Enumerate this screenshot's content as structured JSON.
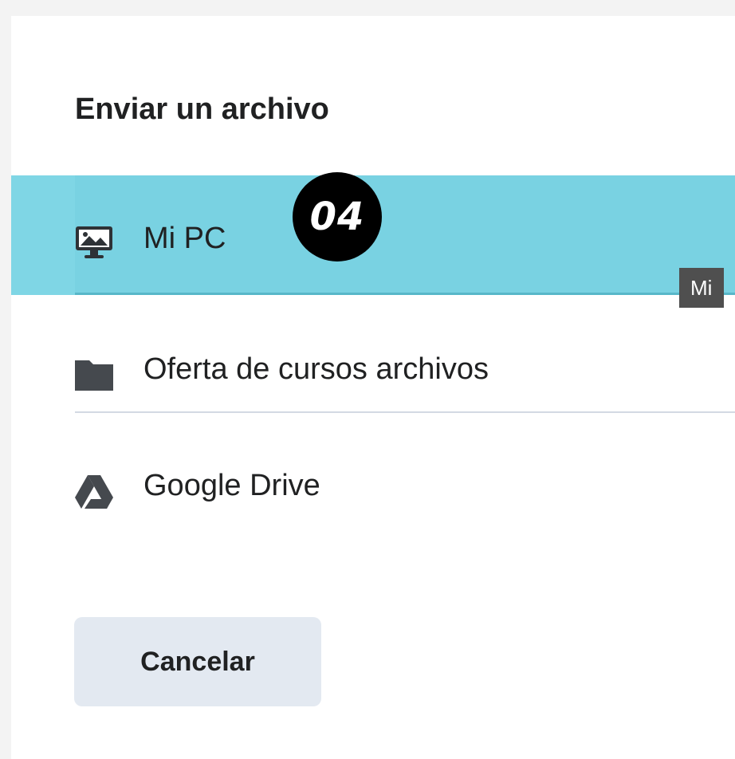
{
  "dialog": {
    "title": "Enviar un archivo",
    "options": [
      {
        "label": "Mi PC",
        "icon": "monitor-icon",
        "selected": true
      },
      {
        "label": "Oferta de cursos archivos",
        "icon": "folder-icon",
        "selected": false
      },
      {
        "label": "Google Drive",
        "icon": "google-drive-icon",
        "selected": false
      }
    ],
    "cancel_label": "Cancelar"
  },
  "annotation": {
    "badge": "04"
  },
  "tooltip": {
    "text": "Mi"
  },
  "colors": {
    "highlight": "#79d2e2",
    "button_bg": "#e3e9f1",
    "text": "#202122",
    "badge_bg": "#000000"
  }
}
